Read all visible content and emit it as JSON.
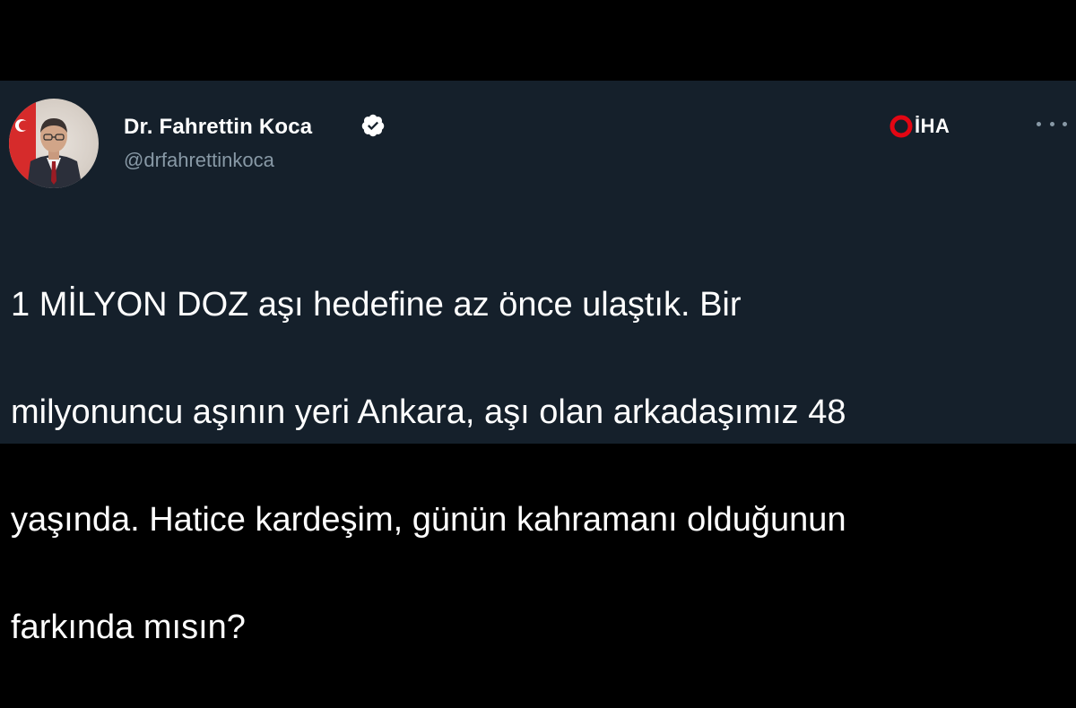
{
  "tweet": {
    "author": {
      "display_name": "Dr. Fahrettin Koca",
      "handle": "@drfahrettinkoca",
      "verified": true,
      "avatar_icon": "profile-photo"
    },
    "watermark": {
      "label": "İHA",
      "brand_color": "#e30613"
    },
    "more_icon": "more-horizontal-icon",
    "lines": [
      "1 MİLYON DOZ aşı hedefine az önce ulaştık. Bir",
      "milyonuncu aşının yeri Ankara, aşı olan arkadaşımız 48",
      "yaşında. Hatice kardeşim, günün kahramanı olduğunun",
      "farkında mısın?"
    ]
  },
  "colors": {
    "card_background": "#15202b",
    "page_background": "#000000",
    "primary_text": "#ffffff",
    "secondary_text": "#8899a6"
  }
}
